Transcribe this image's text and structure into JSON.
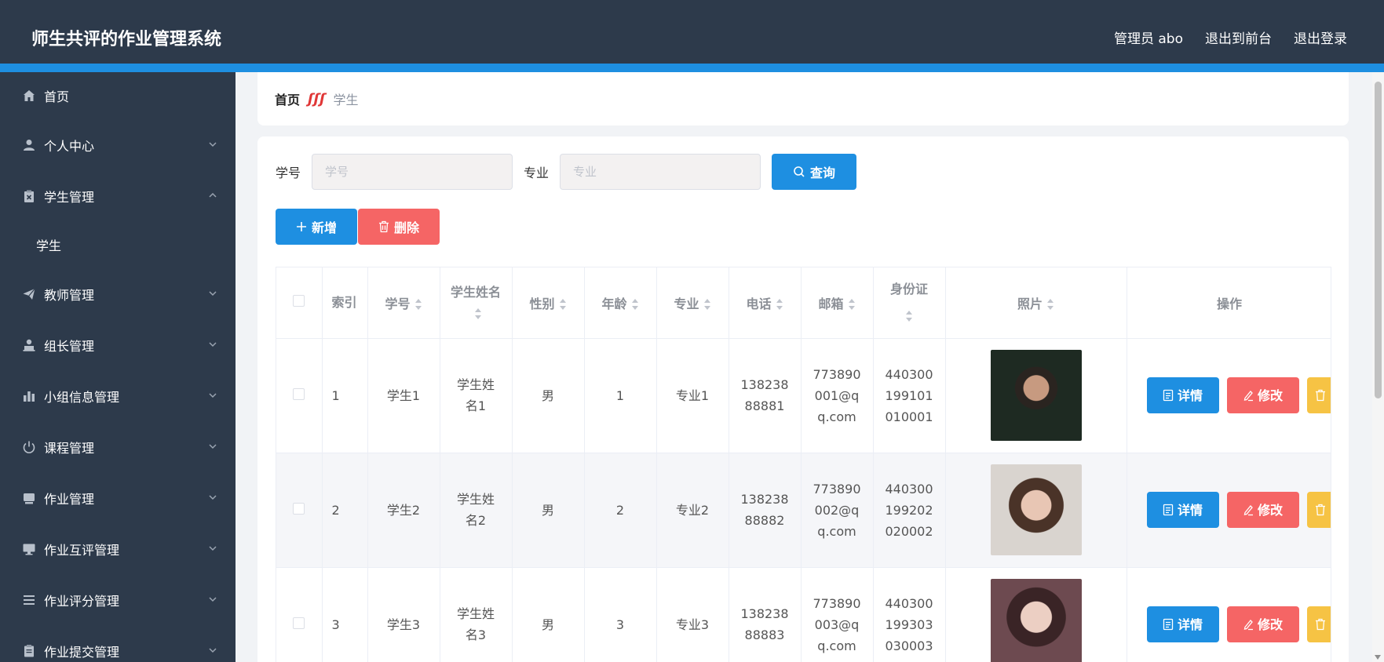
{
  "header": {
    "title": "师生共评的作业管理系统",
    "admin": "管理员 abo",
    "back_front": "退出到前台",
    "logout": "退出登录"
  },
  "sidebar": {
    "items": [
      {
        "label": "首页",
        "icon": "home-icon"
      },
      {
        "label": "个人中心",
        "icon": "user-icon"
      },
      {
        "label": "学生管理",
        "icon": "clipboard-icon",
        "expanded": true
      },
      {
        "label": "学生",
        "sub": true
      },
      {
        "label": "教师管理",
        "icon": "send-icon"
      },
      {
        "label": "组长管理",
        "icon": "person-icon"
      },
      {
        "label": "小组信息管理",
        "icon": "bar-chart-icon"
      },
      {
        "label": "课程管理",
        "icon": "power-icon"
      },
      {
        "label": "作业管理",
        "icon": "inbox-icon"
      },
      {
        "label": "作业互评管理",
        "icon": "monitor-icon"
      },
      {
        "label": "作业评分管理",
        "icon": "list-icon"
      },
      {
        "label": "作业提交管理",
        "icon": "doc-icon"
      }
    ]
  },
  "breadcrumb": {
    "home": "首页",
    "separator": "ʃʃʃ",
    "current": "学生"
  },
  "search": {
    "xuehao_label": "学号",
    "xuehao_placeholder": "学号",
    "zhuanye_label": "专业",
    "zhuanye_placeholder": "专业",
    "query_label": "查询"
  },
  "actions": {
    "add_label": "新增",
    "delete_label": "删除"
  },
  "table": {
    "headers": {
      "index": "索引",
      "xuehao": "学号",
      "name": "学生姓名",
      "gender": "性别",
      "age": "年龄",
      "major": "专业",
      "phone": "电话",
      "email": "邮箱",
      "idcard": "身份证",
      "photo": "照片",
      "ops": "操作"
    },
    "rows": [
      {
        "index": "1",
        "xuehao": "学生1",
        "name": "学生姓名1",
        "gender": "男",
        "age": "1",
        "major": "专业1",
        "phone": "13823888881",
        "email": "773890001@qq.com",
        "idcard": "440300199101010001"
      },
      {
        "index": "2",
        "xuehao": "学生2",
        "name": "学生姓名2",
        "gender": "男",
        "age": "2",
        "major": "专业2",
        "phone": "13823888882",
        "email": "773890002@qq.com",
        "idcard": "440300199202020002"
      },
      {
        "index": "3",
        "xuehao": "学生3",
        "name": "学生姓名3",
        "gender": "男",
        "age": "3",
        "major": "专业3",
        "phone": "13823888883",
        "email": "773890003@qq.com",
        "idcard": "440300199303030003"
      }
    ],
    "detail_label": "详情",
    "edit_label": "修改"
  },
  "colors": {
    "header_bg": "#2d3a4b",
    "accent_blue": "#1e8fe1",
    "danger_red": "#f56565",
    "warning_yellow": "#f6c344"
  }
}
